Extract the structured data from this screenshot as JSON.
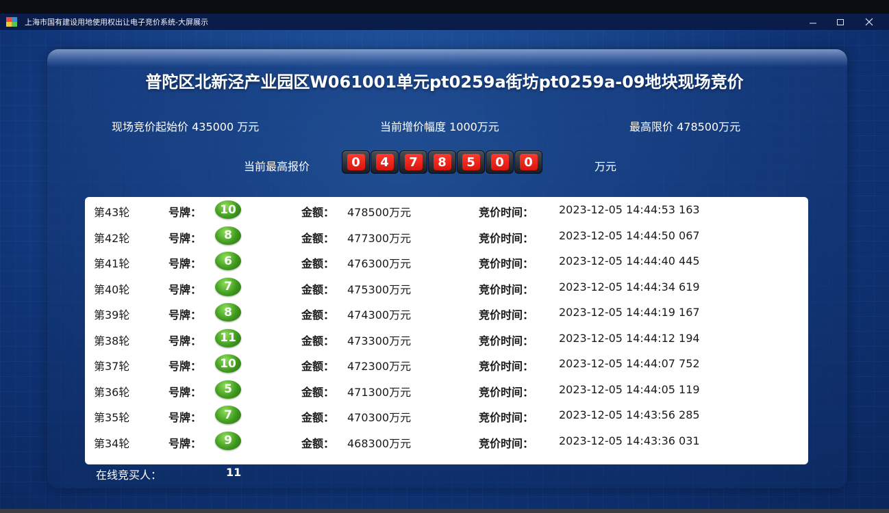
{
  "window": {
    "title": "上海市国有建设用地使用权出让电子竞价系统-大屏展示"
  },
  "header": {
    "title": "普陀区北新泾产业园区W061001单元pt0259a街坊pt0259a-09地块现场竞价",
    "start_price": "现场竞价起始价 435000 万元",
    "increment": "当前增价幅度 1000万元",
    "max_price": "最高限价 478500万元",
    "highest_label": "当前最高报价",
    "highest_digits": [
      "0",
      "4",
      "7",
      "8",
      "5",
      "0",
      "0"
    ],
    "highest_unit": "万元"
  },
  "labels": {
    "plate": "号牌：",
    "amount": "金额：",
    "time": "竞价时间："
  },
  "bids": [
    {
      "round": "第43轮",
      "plate": "10",
      "amount": "478500万元",
      "time": "2023-12-05 14:44:53 163"
    },
    {
      "round": "第42轮",
      "plate": "8",
      "amount": "477300万元",
      "time": "2023-12-05 14:44:50 067"
    },
    {
      "round": "第41轮",
      "plate": "6",
      "amount": "476300万元",
      "time": "2023-12-05 14:44:40 445"
    },
    {
      "round": "第40轮",
      "plate": "7",
      "amount": "475300万元",
      "time": "2023-12-05 14:44:34 619"
    },
    {
      "round": "第39轮",
      "plate": "8",
      "amount": "474300万元",
      "time": "2023-12-05 14:44:19 167"
    },
    {
      "round": "第38轮",
      "plate": "11",
      "amount": "473300万元",
      "time": "2023-12-05 14:44:12 194"
    },
    {
      "round": "第37轮",
      "plate": "10",
      "amount": "472300万元",
      "time": "2023-12-05 14:44:07 752"
    },
    {
      "round": "第36轮",
      "plate": "5",
      "amount": "471300万元",
      "time": "2023-12-05 14:44:05 119"
    },
    {
      "round": "第35轮",
      "plate": "7",
      "amount": "470300万元",
      "time": "2023-12-05 14:43:56 285"
    },
    {
      "round": "第34轮",
      "plate": "9",
      "amount": "468300万元",
      "time": "2023-12-05 14:43:36 031"
    }
  ],
  "footer": {
    "online_label": "在线竞买人：",
    "online_count": "11"
  },
  "colors": {
    "titlebar": "#0a1d4a",
    "background": "#1b4b93",
    "digit_red": "#e0221a",
    "badge_green": "#3f9a1e"
  },
  "icons": {
    "app": "app-logo-icon",
    "minimize": "minimize-icon",
    "maximize": "maximize-icon",
    "close": "close-icon"
  }
}
